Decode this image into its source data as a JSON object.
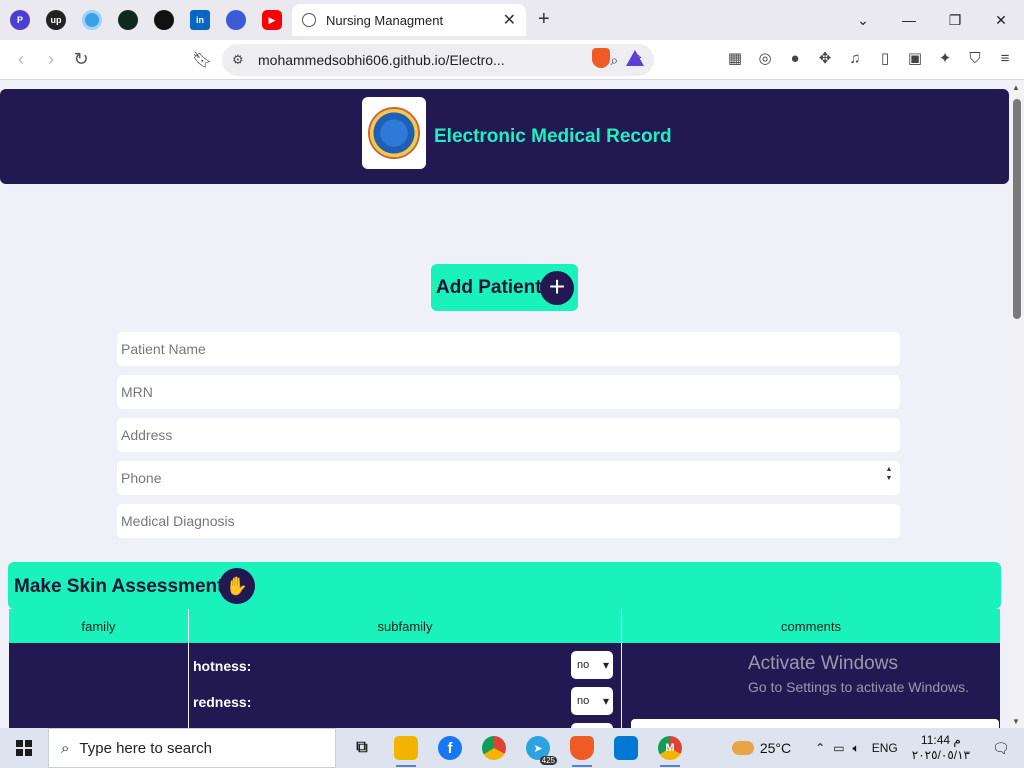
{
  "browser": {
    "pinned_tabs": [
      {
        "icon": "proton-pass-icon",
        "glyph": "P",
        "color": "#4a3fcf"
      },
      {
        "icon": "upwork-icon",
        "glyph": "up",
        "color": "#222"
      },
      {
        "icon": "circle-app-icon",
        "glyph": "",
        "color": "#3aa0e8"
      },
      {
        "icon": "leaf-app-icon",
        "glyph": "",
        "color": "#0d2a1e"
      },
      {
        "icon": "github-icon",
        "glyph": "",
        "color": "#111"
      },
      {
        "icon": "linkedin-icon",
        "glyph": "in",
        "color": "#0a66c2"
      },
      {
        "icon": "crypto-app-icon",
        "glyph": "",
        "color": "#3b5bd6"
      },
      {
        "icon": "youtube-icon",
        "glyph": "▶",
        "color": "#ff0000"
      }
    ],
    "active_tab_title": "Nursing Managment",
    "url": "mohammedsobhi606.github.io/Electro..."
  },
  "header": {
    "title": "Electronic Medical Record"
  },
  "add_patient": {
    "label": "Add Patient",
    "plus": "+"
  },
  "form": {
    "patient_name_placeholder": "Patient Name",
    "mrn_placeholder": "MRN",
    "address_placeholder": "Address",
    "phone_placeholder": "Phone",
    "diagnosis_placeholder": "Medical Diagnosis"
  },
  "skin": {
    "title": "Make Skin Assessment",
    "hand": "✋",
    "columns": [
      "family",
      "subfamily",
      "comments"
    ],
    "rows": [
      {
        "label": "hotness:",
        "value": "no"
      },
      {
        "label": "redness:",
        "value": "no"
      }
    ]
  },
  "watermark": {
    "line1": "Activate Windows",
    "line2": "Go to Settings to activate Windows."
  },
  "taskbar": {
    "search_placeholder": "Type here to search",
    "apps": [
      {
        "icon": "task-view-icon",
        "glyph": "⧉",
        "color": "#333"
      },
      {
        "icon": "file-explorer-icon",
        "glyph": "",
        "color": "#f2b400"
      },
      {
        "icon": "facebook-icon",
        "glyph": "f",
        "color": "#1877f2"
      },
      {
        "icon": "chrome-icon",
        "glyph": "",
        "color": "#db4437"
      },
      {
        "icon": "telegram-icon",
        "glyph": "➤",
        "color": "#2aa3e0",
        "badge": "425"
      },
      {
        "icon": "brave-icon",
        "glyph": "",
        "color": "#f05a24"
      },
      {
        "icon": "vscode-icon",
        "glyph": "",
        "color": "#0078d4"
      },
      {
        "icon": "chrome-profile-icon",
        "glyph": "M",
        "color": "#c0392b"
      }
    ],
    "weather_temp": "25°C",
    "language": "ENG",
    "time": "11:44 م",
    "date": "٢٠٢٥/٠٥/١٣"
  }
}
